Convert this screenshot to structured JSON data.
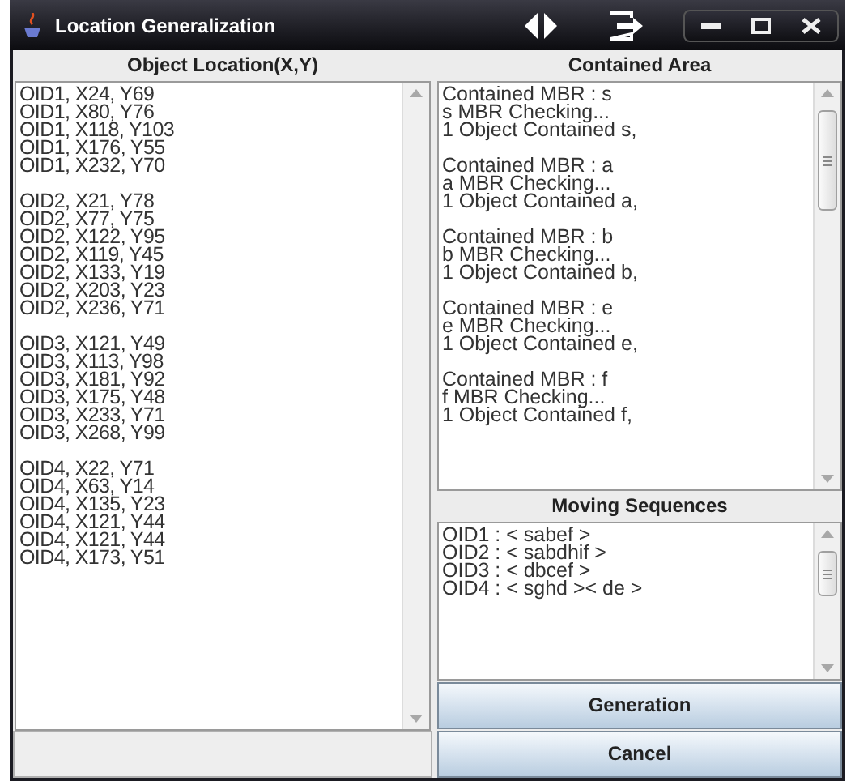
{
  "window": {
    "title": "Location Generalization"
  },
  "object_location": {
    "header": "Object Location(X,Y)",
    "groups": [
      [
        "OID1, X24, Y69",
        "OID1, X80, Y76",
        "OID1, X118, Y103",
        "OID1, X176, Y55",
        "OID1, X232, Y70"
      ],
      [
        "OID2, X21, Y78",
        "OID2, X77, Y75",
        "OID2, X122, Y95",
        "OID2, X119, Y45",
        "OID2, X133, Y19",
        "OID2, X203, Y23",
        "OID2, X236, Y71"
      ],
      [
        "OID3, X121, Y49",
        "OID3, X113, Y98",
        "OID3, X181, Y92",
        "OID3, X175, Y48",
        "OID3, X233, Y71",
        "OID3, X268, Y99"
      ],
      [
        "OID4, X22, Y71",
        "OID4, X63, Y14",
        "OID4, X135, Y23",
        "OID4, X121, Y44",
        "OID4, X121, Y44",
        "OID4, X173, Y51"
      ]
    ]
  },
  "contained_area": {
    "header": "Contained Area",
    "groups": [
      [
        "Contained MBR : s",
        "s MBR Checking...",
        "1 Object Contained s,"
      ],
      [
        "Contained MBR : a",
        "a MBR Checking...",
        "1 Object Contained a,"
      ],
      [
        "Contained MBR : b",
        "b MBR Checking...",
        "1 Object Contained b,"
      ],
      [
        "Contained MBR : e",
        "e MBR Checking...",
        "1 Object Contained e,"
      ],
      [
        "Contained MBR : f",
        "f MBR Checking...",
        "1 Object Contained f,"
      ]
    ]
  },
  "moving_sequences": {
    "header": "Moving Sequences",
    "lines": [
      "OID1 : < sabef >",
      "OID2 : < sabdhif >",
      "OID3 : < dbcef >",
      "OID4 : < sghd >< de >"
    ]
  },
  "buttons": [
    "Generation",
    "Cancel"
  ]
}
